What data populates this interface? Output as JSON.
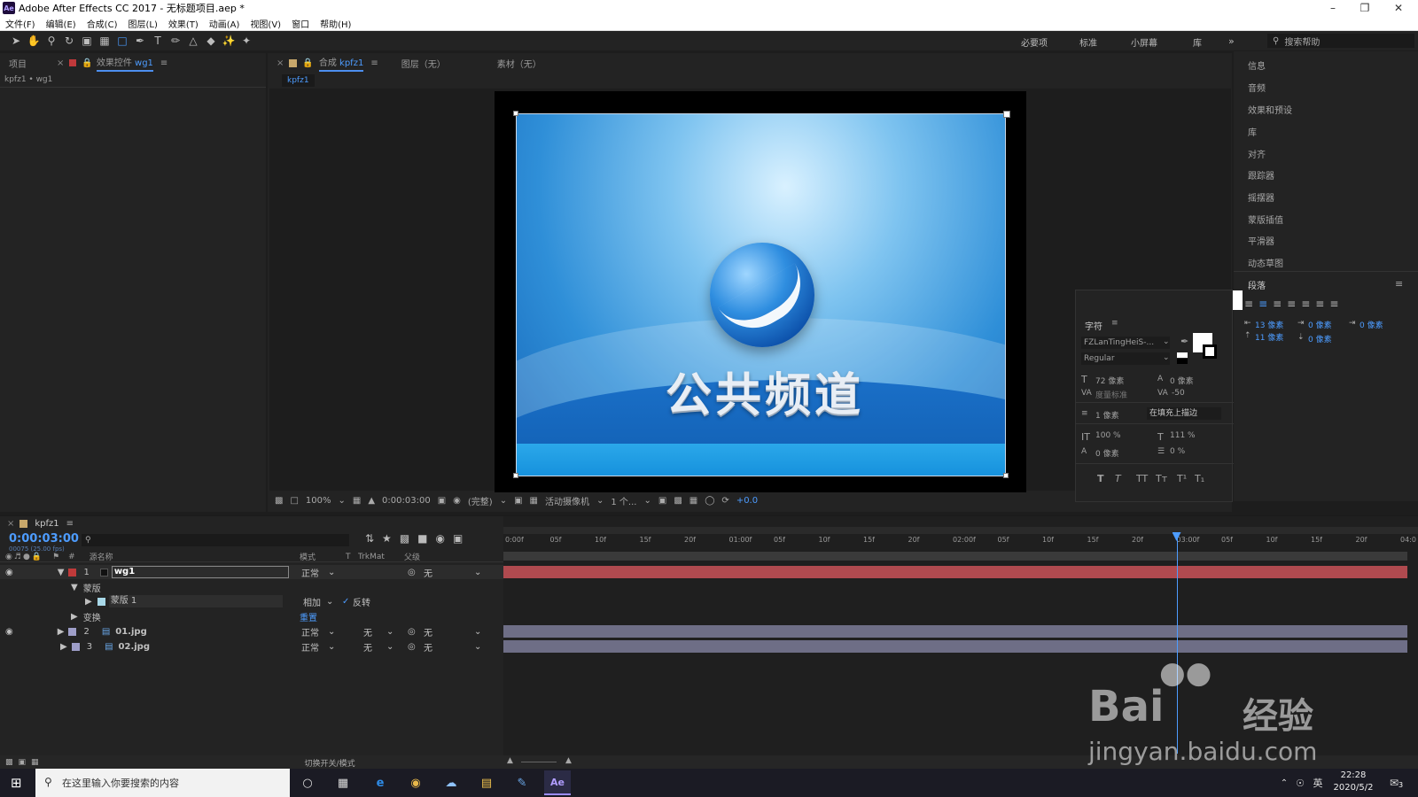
{
  "window": {
    "title": "Adobe After Effects CC 2017 - 无标题项目.aep *",
    "app_icon": "Ae"
  },
  "menu": [
    "文件(F)",
    "编辑(E)",
    "合成(C)",
    "图层(L)",
    "效果(T)",
    "动画(A)",
    "视图(V)",
    "窗口",
    "帮助(H)"
  ],
  "workspaces": [
    "必要项",
    "标准",
    "小屏幕",
    "库"
  ],
  "help_search_placeholder": "搜索帮助",
  "left_panel": {
    "tab_project": "项目",
    "tab_effects": "效果控件",
    "tab_effects_target": "wg1",
    "breadcrumb": "kpfz1 • wg1"
  },
  "viewer": {
    "tab_comp_label": "合成",
    "tab_comp_name": "kpfz1",
    "tab_layer": "图层（无）",
    "tab_footage": "素材（无）",
    "comp_chip": "kpfz1",
    "logo_text": "公共频道",
    "zoom": "100%",
    "timecode": "0:00:03:00",
    "resolution": "(完整)",
    "camera": "活动摄像机",
    "views": "1 个...",
    "exposure": "+0.0"
  },
  "right_panel": {
    "items": [
      "信息",
      "音频",
      "效果和预设",
      "库",
      "对齐",
      "跟踪器",
      "摇摆器",
      "蒙版插值",
      "平滑器",
      "动态草图"
    ],
    "paragraph_title": "段落",
    "para_indent_left": "13 像素",
    "para_indent_right": "0 像素",
    "para_indent_first": "0 像素",
    "para_space_before": "11 像素",
    "para_space_after": "0 像素"
  },
  "character": {
    "title": "字符",
    "font": "FZLanTingHeiS-...",
    "style": "Regular",
    "size": "72 像素",
    "leading": "0 像素",
    "kerning": "度量标准",
    "tracking": "-50",
    "stroke": "1 像素",
    "stroke_mode": "在填充上描边",
    "vscale": "100 %",
    "hscale": "111 %",
    "baseline": "0 像素",
    "tsume": "0 %",
    "styles": [
      "T",
      "T",
      "TT",
      "Tт",
      "T¹",
      "T₁"
    ]
  },
  "timeline": {
    "comp_name": "kpfz1",
    "timecode": "0:00:03:00",
    "frame_info": "00075 (25.00 fps)",
    "search_placeholder": "",
    "columns": {
      "source": "源名称",
      "mode": "模式",
      "t": "T",
      "trkmat": "TrkMat",
      "parent": "父级"
    },
    "ruler": [
      "0:00f",
      "05f",
      "10f",
      "15f",
      "20f",
      "01:00f",
      "05f",
      "10f",
      "15f",
      "20f",
      "02:00f",
      "05f",
      "10f",
      "15f",
      "20f",
      "03:00f",
      "05f",
      "10f",
      "15f",
      "20f",
      "04:0"
    ],
    "layers": [
      {
        "num": "1",
        "name": "wg1",
        "mode": "正常",
        "trkmat": "",
        "parent": "无",
        "color": "#c03a3a"
      },
      {
        "num": "2",
        "name": "01.jpg",
        "mode": "正常",
        "trkmat": "无",
        "parent": "无",
        "color": "#9e9ec8"
      },
      {
        "num": "3",
        "name": "02.jpg",
        "mode": "正常",
        "trkmat": "无",
        "parent": "无",
        "color": "#9e9ec8"
      }
    ],
    "mask_group": "蒙版",
    "mask_name": "蒙版 1",
    "mask_mode": "相加",
    "mask_invert": "反转",
    "transform": "变换",
    "reset": "重置",
    "footer_toggle": "切换开关/模式",
    "playhead_fraction": 0.75
  },
  "taskbar": {
    "search_placeholder": "在这里输入你要搜索的内容",
    "ime_lang": "英",
    "time": "22:28",
    "date": "2020/5/2",
    "notif_count": "3"
  },
  "watermark": {
    "brand": "Bai",
    "brand2": "经验",
    "url": "jingyan.baidu.com"
  }
}
